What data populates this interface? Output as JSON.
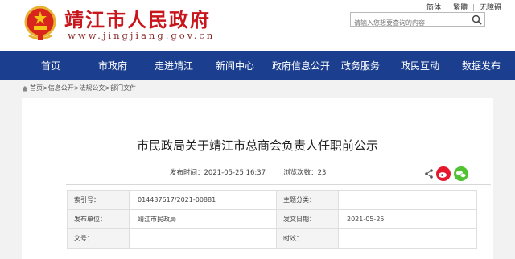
{
  "header": {
    "site_title": "靖江市人民政府",
    "site_domain": "www.jingjiang.gov.cn",
    "links": [
      "简体",
      "繁體",
      "无障碍"
    ],
    "search_placeholder": "请输入您想要查询的内容"
  },
  "nav": {
    "items": [
      "首页",
      "市政府",
      "走进靖江",
      "新闻中心",
      "政府信息公开",
      "政务服务",
      "政民互动",
      "数据发布"
    ]
  },
  "breadcrumb": {
    "items": [
      "首页",
      "信息公开",
      "法规公文",
      "部门文件"
    ],
    "separator": ">"
  },
  "article": {
    "title": "市民政局关于靖江市总商会负责人任职前公示",
    "publish_label": "发布时间：",
    "publish_time": "2021-05-25 16:37",
    "views_label": "浏览次数：",
    "views": "23"
  },
  "info_table": {
    "rows": [
      {
        "k1": "索引号：",
        "v1": "014437617/2021-00881",
        "k2": "主题分类：",
        "v2": ""
      },
      {
        "k1": "发布单位：",
        "v1": "靖江市民政局",
        "k2": "发文日期：",
        "v2": "2021-05-25"
      },
      {
        "k1": "文号：",
        "v1": "",
        "k2": "时效：",
        "v2": ""
      }
    ]
  },
  "colors": {
    "brand_red": "#c8161d",
    "nav_blue": "#1b3e8f",
    "weibo_red": "#e6162d",
    "wechat_green": "#51c332"
  }
}
